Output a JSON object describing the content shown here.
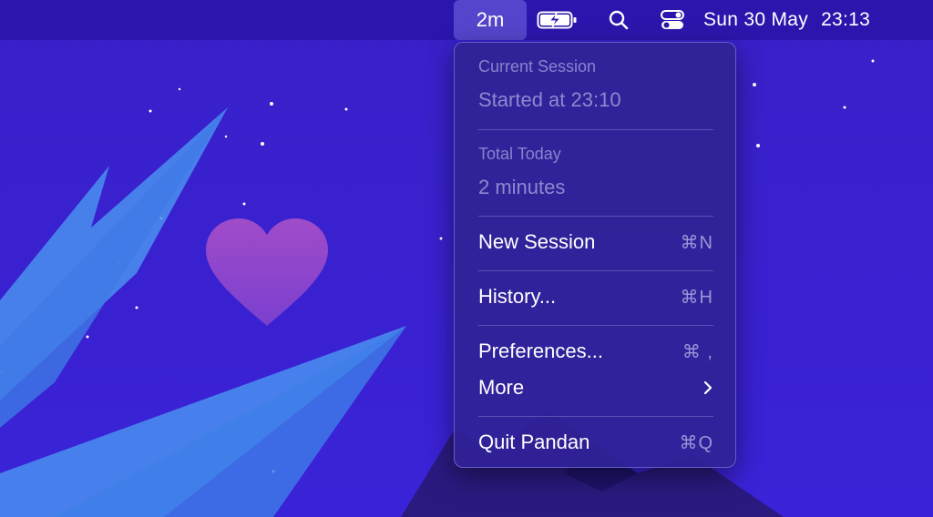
{
  "menubar": {
    "timer": "2m",
    "battery_icon": "battery-charging-icon",
    "search_icon": "search-icon",
    "control_icon": "control-center-icon",
    "date": "Sun 30 May",
    "time": "23:13"
  },
  "menu": {
    "current_session_heading": "Current Session",
    "started_at": "Started at 23:10",
    "total_today_heading": "Total Today",
    "total_today_value": "2 minutes",
    "items": [
      {
        "label": "New Session",
        "shortcut": "⌘N"
      },
      {
        "label": "History...",
        "shortcut": "⌘H"
      },
      {
        "label": "Preferences...",
        "shortcut": "⌘ ,"
      },
      {
        "label": "More",
        "submenu": true
      },
      {
        "label": "Quit Pandan",
        "shortcut": "⌘Q"
      }
    ]
  },
  "colors": {
    "wallpaper": "#3a1fd0",
    "heart": "#9a4fd0",
    "leaf": "#4a90f0"
  }
}
